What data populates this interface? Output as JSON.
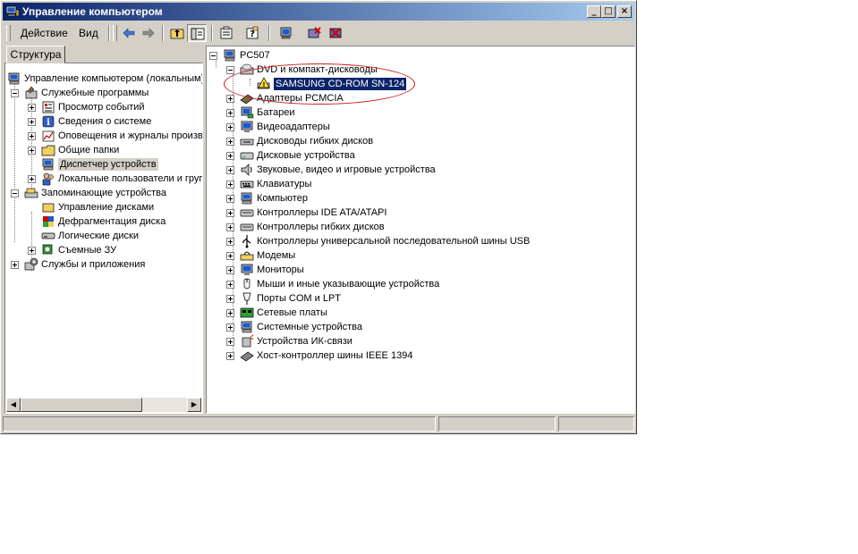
{
  "window": {
    "title": "Управление компьютером",
    "controls": {
      "minimize": "_",
      "maximize": "□",
      "close": "×"
    }
  },
  "menu": {
    "action": "Действие",
    "view": "Вид"
  },
  "toolbar": {
    "buttons": [
      "back-arrow-icon",
      "forward-arrow-icon",
      "up-folder-icon",
      "show-hide-tree-icon",
      "properties-icon",
      "help-icon",
      "scan-hardware-icon",
      "uninstall-device-icon",
      "disable-device-icon"
    ]
  },
  "left_tab": "Структура",
  "left_tree": [
    {
      "label": "Управление компьютером (локальным)",
      "level": 0
    },
    {
      "label": "Служебные программы",
      "level": 1
    },
    {
      "label": "Просмотр событий",
      "level": 2
    },
    {
      "label": "Сведения о системе",
      "level": 2
    },
    {
      "label": "Оповещения и журналы производительности",
      "level": 2
    },
    {
      "label": "Общие папки",
      "level": 2
    },
    {
      "label": "Диспетчер устройств",
      "level": 2,
      "selected": true
    },
    {
      "label": "Локальные пользователи и группы",
      "level": 2
    },
    {
      "label": "Запоминающие устройства",
      "level": 1
    },
    {
      "label": "Управление дисками",
      "level": 2
    },
    {
      "label": "Дефрагментация диска",
      "level": 2
    },
    {
      "label": "Логические диски",
      "level": 2
    },
    {
      "label": "Съемные ЗУ",
      "level": 2
    },
    {
      "label": "Службы и приложения",
      "level": 1
    }
  ],
  "device_tree": {
    "root": "PC507",
    "expanded": "DVD и компакт-дисководы",
    "child": "SAMSUNG CD-ROM SN-124",
    "categories": [
      "Адаптеры PCMCIA",
      "Батареи",
      "Видеоадаптеры",
      "Дисководы гибких дисков",
      "Дисковые устройства",
      "Звуковые, видео и игровые устройства",
      "Клавиатуры",
      "Компьютер",
      "Контроллеры IDE ATA/ATAPI",
      "Контроллеры гибких дисков",
      "Контроллеры универсальной последовательной шины USB",
      "Модемы",
      "Мониторы",
      "Мыши и иные указывающие устройства",
      "Порты COM и LPT",
      "Сетевые платы",
      "Системные устройства",
      "Устройства ИК-связи",
      "Хост-контроллер шины IEEE 1394"
    ]
  },
  "colors": {
    "title_start": "#0a246a",
    "title_end": "#a6caf0",
    "selection": "#0a246a",
    "annotation": "#cc1a1a"
  }
}
